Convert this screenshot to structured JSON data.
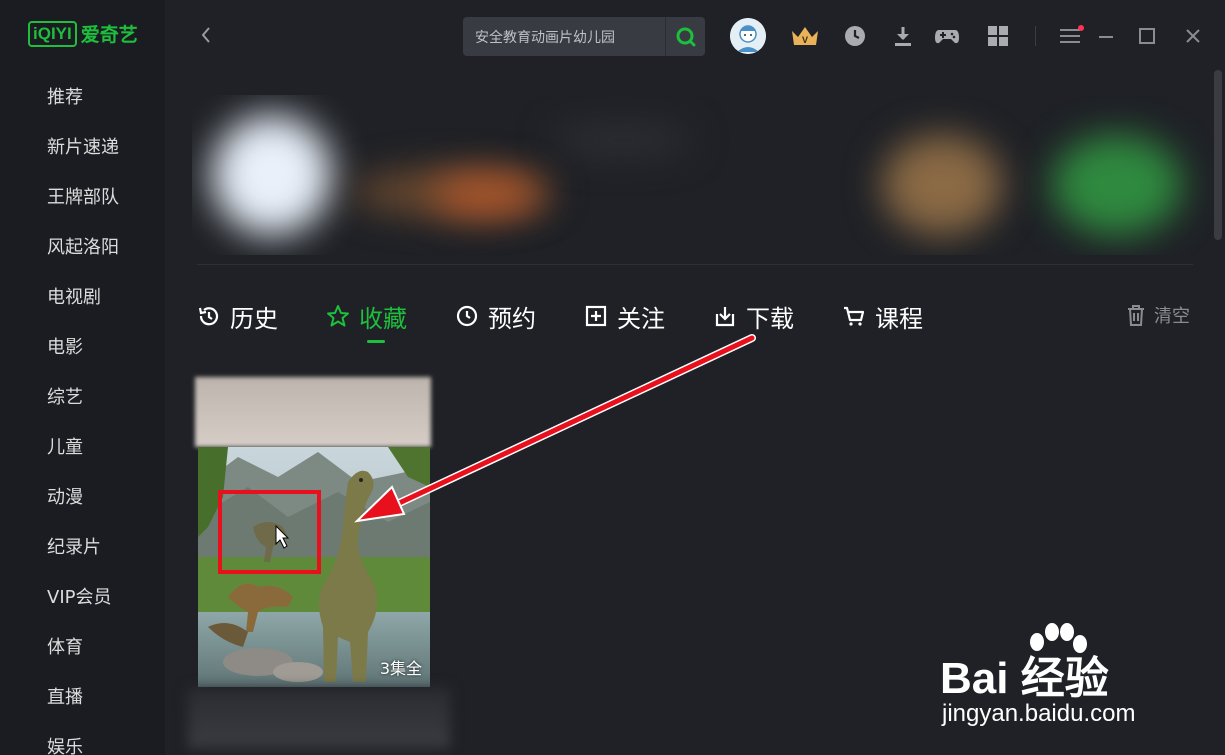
{
  "app": {
    "logo_text": "爱奇艺",
    "logo_box": "iQIYI"
  },
  "sidebar": {
    "items": [
      {
        "label": "推荐"
      },
      {
        "label": "新片速递"
      },
      {
        "label": "王牌部队"
      },
      {
        "label": "风起洛阳"
      },
      {
        "label": "电视剧"
      },
      {
        "label": "电影"
      },
      {
        "label": "综艺"
      },
      {
        "label": "儿童"
      },
      {
        "label": "动漫"
      },
      {
        "label": "纪录片"
      },
      {
        "label": "VIP会员"
      },
      {
        "label": "体育"
      },
      {
        "label": "直播"
      },
      {
        "label": "娱乐"
      }
    ]
  },
  "search": {
    "value": "安全教育动画片幼儿园"
  },
  "tabs": [
    {
      "label": "历史",
      "icon": "history-icon"
    },
    {
      "label": "收藏",
      "icon": "star-icon",
      "active": true
    },
    {
      "label": "预约",
      "icon": "clock-icon"
    },
    {
      "label": "关注",
      "icon": "plus-box-icon"
    },
    {
      "label": "下载",
      "icon": "download-icon"
    },
    {
      "label": "课程",
      "icon": "cart-icon"
    }
  ],
  "actions": {
    "clear_label": "清空"
  },
  "card": {
    "episodes": "3集全"
  },
  "watermark": {
    "brand": "Bai 经验",
    "url": "jingyan.baidu.com"
  },
  "colors": {
    "accent": "#1dbf3c",
    "background": "#1f2126",
    "annotation": "#e8101c",
    "notification": "#ff3355"
  }
}
